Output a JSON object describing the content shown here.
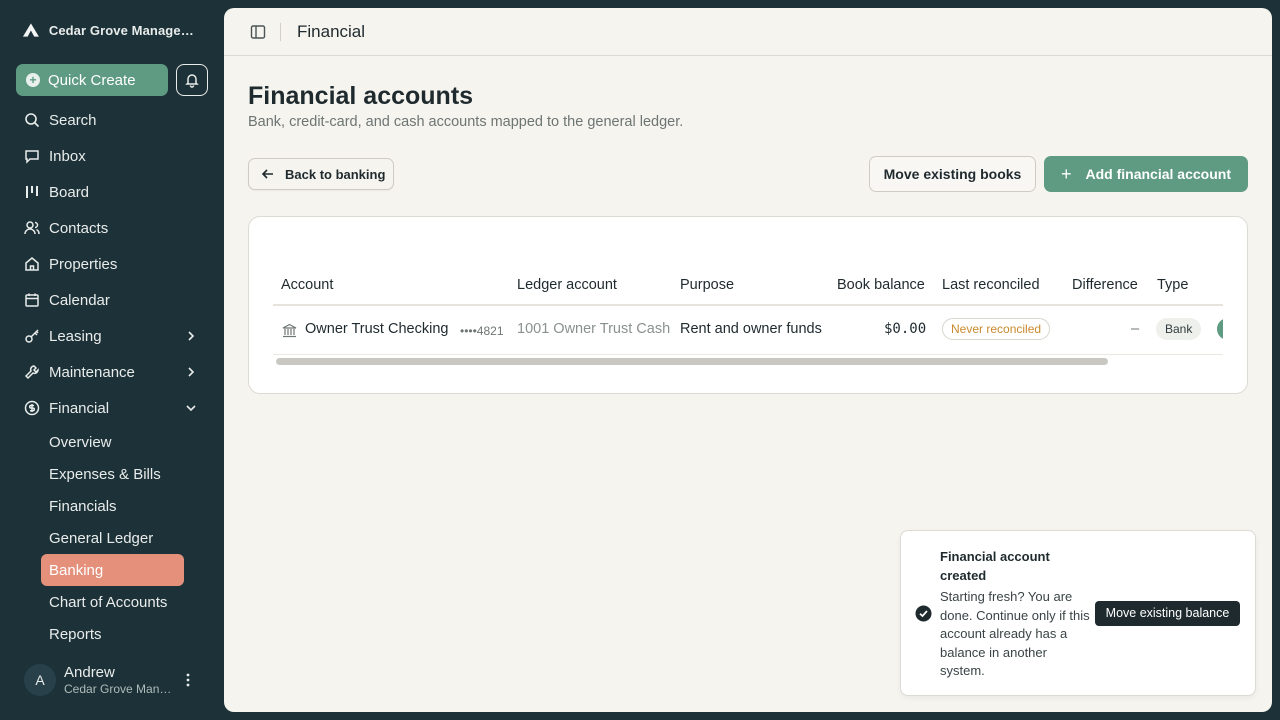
{
  "app": {
    "org_name": "Cedar Grove Management",
    "quick_create_label": "Quick Create"
  },
  "sidebar": {
    "items": [
      {
        "label": "Search",
        "icon": "search-icon"
      },
      {
        "label": "Inbox",
        "icon": "inbox-icon"
      },
      {
        "label": "Board",
        "icon": "board-icon"
      },
      {
        "label": "Contacts",
        "icon": "contacts-icon"
      },
      {
        "label": "Properties",
        "icon": "home-icon"
      },
      {
        "label": "Calendar",
        "icon": "calendar-icon"
      },
      {
        "label": "Leasing",
        "icon": "key-icon"
      },
      {
        "label": "Maintenance",
        "icon": "wrench-icon"
      },
      {
        "label": "Financial",
        "icon": "dollar-icon"
      }
    ],
    "financial_sub": [
      "Overview",
      "Expenses & Bills",
      "Financials",
      "General Ledger",
      "Banking",
      "Chart of Accounts",
      "Reports"
    ],
    "active_sub": "Banking"
  },
  "user": {
    "initial": "A",
    "name": "Andrew",
    "org": "Cedar Grove Management"
  },
  "topbar": {
    "title": "Financial"
  },
  "page": {
    "title": "Financial accounts",
    "subtitle": "Bank, credit-card, and cash accounts mapped to the general ledger.",
    "back_label": "Back to banking",
    "move_label": "Move existing books",
    "add_label": "Add financial account"
  },
  "table": {
    "headers": [
      "Account",
      "Ledger account",
      "Purpose",
      "Book balance",
      "Last reconciled",
      "Difference",
      "Type"
    ],
    "rows": [
      {
        "account": "Owner Trust Checking",
        "mask": "••••4821",
        "ledger": "1001 Owner Trust Cash",
        "purpose": "Rent and owner funds",
        "balance": "$0.00",
        "reconciled": "Never reconciled",
        "difference": "–",
        "type": "Bank"
      }
    ]
  },
  "toast": {
    "title": "Financial account created",
    "body": "Starting fresh? You are done. Continue only if this account already has a balance in another system.",
    "action": "Move existing balance"
  },
  "colors": {
    "sidebar_bg": "#1d3138",
    "accent_green": "#5f9a82",
    "active_nav": "#e4907b",
    "warning_text": "#c98a2c"
  }
}
